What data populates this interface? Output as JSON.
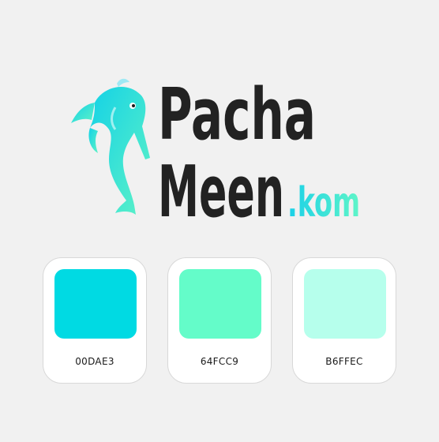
{
  "brand": {
    "word1": "Pacha",
    "word2": "Meen",
    "domain_suffix": ".kom",
    "dark_color": "#222222",
    "accent_color": "#1fe0d8",
    "accent_gradient": [
      "#1ad0e8",
      "#5ff5c8"
    ]
  },
  "palette": [
    {
      "code": "00DAE3",
      "hex": "#00DAE3"
    },
    {
      "code": "64FCC9",
      "hex": "#64FCC9"
    },
    {
      "code": "B6FFEC",
      "hex": "#B6FFEC"
    }
  ]
}
